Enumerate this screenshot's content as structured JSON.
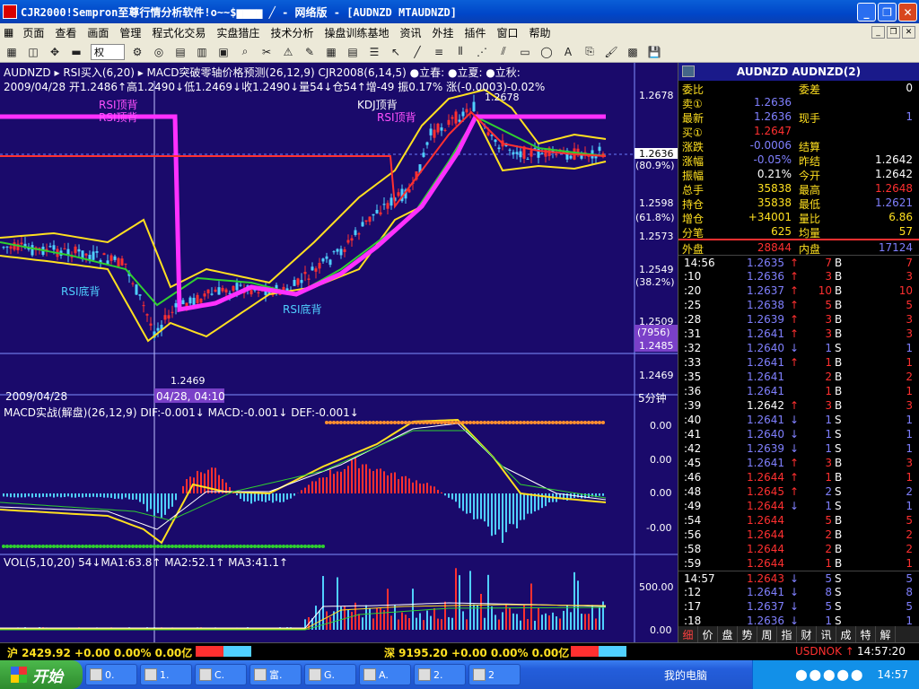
{
  "window": {
    "title": "CJR2000!Sempron至尊行情分析软件!o~~$▆▆▆▆ ╱ - 网络版 - [AUDNZD MTAUDNZD]"
  },
  "menu": [
    "页面",
    "查看",
    "画面",
    "管理",
    "程式化交易",
    "实盘猎庄",
    "技术分析",
    "操盘训练基地",
    "资讯",
    "外挂",
    "插件",
    "窗口",
    "帮助"
  ],
  "toolbar": {
    "combo": "权"
  },
  "chart_header": {
    "line1": "AUDNZD  ▸ RSI买入(6,20)  ▸ MACD突破零轴价格预测(26,12,9)  CJR2008(6,14,5)  ●立春: ●立夏: ●立秋: ",
    "line2": "2009/04/28  开1.2486↑高1.2490↓低1.2469↓收1.2490↓量54↓仓54↑增-49  振0.17%  涨(-0.0003)-0.02%"
  },
  "main_axis": [
    "1.2678",
    "1.2636",
    "(80.9%)",
    "1.2598",
    "(61.8%)",
    "1.2573",
    "1.2549",
    "(38.2%)",
    "1.2509",
    "(7956)",
    "1.2485",
    "1.2469"
  ],
  "annotations": {
    "rsi_top1": "RSI顶背",
    "rsi_top2": "RSI顶背",
    "rsi_top3": "RSI顶背",
    "kdj_top": "KDJ顶背",
    "rsi_bot1": "RSI底背",
    "rsi_bot2": "RSI底背",
    "high_label": "1.2678",
    "low_label": "1.2469",
    "cur_price": "1.2636"
  },
  "mid_bar": {
    "date": "2009/04/28",
    "time": "04/28, 04:10",
    "period": "5分钟"
  },
  "macd_header": "MACD实战(解盘)(26,12,9)  DIF:-0.001↓  MACD:-0.001↓  DEF:-0.001↓",
  "macd_axis": [
    "0.00",
    "0.00",
    "0.00",
    "-0.00"
  ],
  "vol_header": "VOL(5,10,20)  54↓MA1:63.8↑  MA2:52.1↑  MA3:41.1↑",
  "vol_axis": [
    "500.00",
    "0.00"
  ],
  "quote": {
    "symbol": "AUDNZD  AUDNZD(2)",
    "rows": [
      {
        "l": "委比",
        "lv": "",
        "r": "委差",
        "rv": "0",
        "lc": "#ffe020",
        "rc": "#fff"
      },
      {
        "l": "卖①",
        "lv": "1.2636",
        "r": "",
        "rv": "",
        "lc": "#8080ff",
        "rc": "#fff"
      },
      {
        "l": "最新",
        "lv": "1.2636",
        "r": "现手",
        "rv": "1",
        "lc": "#8080ff",
        "rc": "#8080ff"
      },
      {
        "l": "买①",
        "lv": "1.2647",
        "r": "",
        "rv": "",
        "lc": "#ff3030",
        "rc": "#fff"
      },
      {
        "l": "涨跌",
        "lv": "-0.0006",
        "r": "结算",
        "rv": "",
        "lc": "#8080ff",
        "rc": "#fff"
      },
      {
        "l": "涨幅",
        "lv": "-0.05%",
        "r": "昨结",
        "rv": "1.2642",
        "lc": "#8080ff",
        "rc": "#fff"
      },
      {
        "l": "振幅",
        "lv": "0.21%",
        "r": "今开",
        "rv": "1.2642",
        "lc": "#fff",
        "rc": "#fff"
      },
      {
        "l": "总手",
        "lv": "35838",
        "r": "最高",
        "rv": "1.2648",
        "lc": "#ffe020",
        "rc": "#ff3030"
      },
      {
        "l": "持仓",
        "lv": "35838",
        "r": "最低",
        "rv": "1.2621",
        "lc": "#ffe020",
        "rc": "#8080ff"
      },
      {
        "l": "增仓",
        "lv": "+34001",
        "r": "量比",
        "rv": "6.86",
        "lc": "#ffe020",
        "rc": "#ffe020"
      },
      {
        "l": "分笔",
        "lv": "625",
        "r": "均量",
        "rv": "57",
        "lc": "#ffe020",
        "rc": "#ffe020"
      },
      {
        "l": "外盘",
        "lv": "28844",
        "r": "内盘",
        "rv": "17124",
        "lc": "#ff3030",
        "rc": "#8080ff"
      }
    ]
  },
  "ticks": [
    {
      "t": "14:56",
      "p": "1.2635",
      "d": "up",
      "v": "7",
      "s": "B",
      "n": "7",
      "pc": "#8080ff"
    },
    {
      "t": ":10",
      "p": "1.2636",
      "d": "up",
      "v": "3",
      "s": "B",
      "n": "3",
      "pc": "#8080ff"
    },
    {
      "t": ":20",
      "p": "1.2637",
      "d": "up",
      "v": "10",
      "s": "B",
      "n": "10",
      "pc": "#8080ff"
    },
    {
      "t": ":25",
      "p": "1.2638",
      "d": "up",
      "v": "5",
      "s": "B",
      "n": "5",
      "pc": "#8080ff"
    },
    {
      "t": ":28",
      "p": "1.2639",
      "d": "up",
      "v": "3",
      "s": "B",
      "n": "3",
      "pc": "#8080ff"
    },
    {
      "t": ":31",
      "p": "1.2641",
      "d": "up",
      "v": "3",
      "s": "B",
      "n": "3",
      "pc": "#8080ff"
    },
    {
      "t": ":32",
      "p": "1.2640",
      "d": "down",
      "v": "1",
      "s": "S",
      "n": "1",
      "pc": "#8080ff"
    },
    {
      "t": ":33",
      "p": "1.2641",
      "d": "up",
      "v": "1",
      "s": "B",
      "n": "1",
      "pc": "#8080ff"
    },
    {
      "t": ":35",
      "p": "1.2641",
      "d": "",
      "v": "2",
      "s": "B",
      "n": "2",
      "pc": "#8080ff"
    },
    {
      "t": ":36",
      "p": "1.2641",
      "d": "",
      "v": "1",
      "s": "B",
      "n": "1",
      "pc": "#8080ff"
    },
    {
      "t": ":39",
      "p": "1.2642",
      "d": "up",
      "v": "3",
      "s": "B",
      "n": "3",
      "pc": "#fff"
    },
    {
      "t": ":40",
      "p": "1.2641",
      "d": "down",
      "v": "1",
      "s": "S",
      "n": "1",
      "pc": "#8080ff"
    },
    {
      "t": ":41",
      "p": "1.2640",
      "d": "down",
      "v": "1",
      "s": "S",
      "n": "1",
      "pc": "#8080ff"
    },
    {
      "t": ":42",
      "p": "1.2639",
      "d": "down",
      "v": "1",
      "s": "S",
      "n": "1",
      "pc": "#8080ff"
    },
    {
      "t": ":45",
      "p": "1.2641",
      "d": "up",
      "v": "3",
      "s": "B",
      "n": "3",
      "pc": "#8080ff"
    },
    {
      "t": ":46",
      "p": "1.2644",
      "d": "up",
      "v": "1",
      "s": "B",
      "n": "1",
      "pc": "#ff3030"
    },
    {
      "t": ":48",
      "p": "1.2645",
      "d": "up",
      "v": "2",
      "s": "S",
      "n": "2",
      "pc": "#ff3030"
    },
    {
      "t": ":49",
      "p": "1.2644",
      "d": "down",
      "v": "1",
      "s": "S",
      "n": "1",
      "pc": "#ff3030"
    },
    {
      "t": ":54",
      "p": "1.2644",
      "d": "",
      "v": "5",
      "s": "B",
      "n": "5",
      "pc": "#ff3030"
    },
    {
      "t": ":56",
      "p": "1.2644",
      "d": "",
      "v": "2",
      "s": "B",
      "n": "2",
      "pc": "#ff3030"
    },
    {
      "t": ":58",
      "p": "1.2644",
      "d": "",
      "v": "2",
      "s": "B",
      "n": "2",
      "pc": "#ff3030"
    },
    {
      "t": ":59",
      "p": "1.2644",
      "d": "",
      "v": "1",
      "s": "B",
      "n": "1",
      "pc": "#ff3030"
    },
    {
      "t": "14:57",
      "p": "1.2643",
      "d": "down",
      "v": "5",
      "s": "S",
      "n": "5",
      "pc": "#ff3030"
    },
    {
      "t": ":12",
      "p": "1.2641",
      "d": "down",
      "v": "8",
      "s": "S",
      "n": "8",
      "pc": "#8080ff"
    },
    {
      "t": ":17",
      "p": "1.2637",
      "d": "down",
      "v": "5",
      "s": "S",
      "n": "5",
      "pc": "#8080ff"
    },
    {
      "t": ":18",
      "p": "1.2636",
      "d": "down",
      "v": "1",
      "s": "S",
      "n": "1",
      "pc": "#8080ff"
    }
  ],
  "rtabs": [
    "细",
    "价",
    "盘",
    "势",
    "周",
    "指",
    "财",
    "讯",
    "成",
    "特",
    "解"
  ],
  "status": {
    "sh": "沪 2429.92 +0.00 0.00% 0.00亿",
    "sz": "深 9195.20 +0.00 0.00% 0.00亿",
    "ticker": "USDNOK ↑",
    "time": "14:57:20"
  },
  "taskbar": {
    "start": "开始",
    "tasks": [
      "0.",
      "1.",
      "C.",
      "富.",
      "G.",
      "A.",
      "2.",
      "2"
    ],
    "mypc": "我的电脑",
    "clock": "14:57"
  },
  "colors": {
    "up": "#ff3030",
    "down": "#8080ff",
    "bg": "#1a0a6b"
  }
}
